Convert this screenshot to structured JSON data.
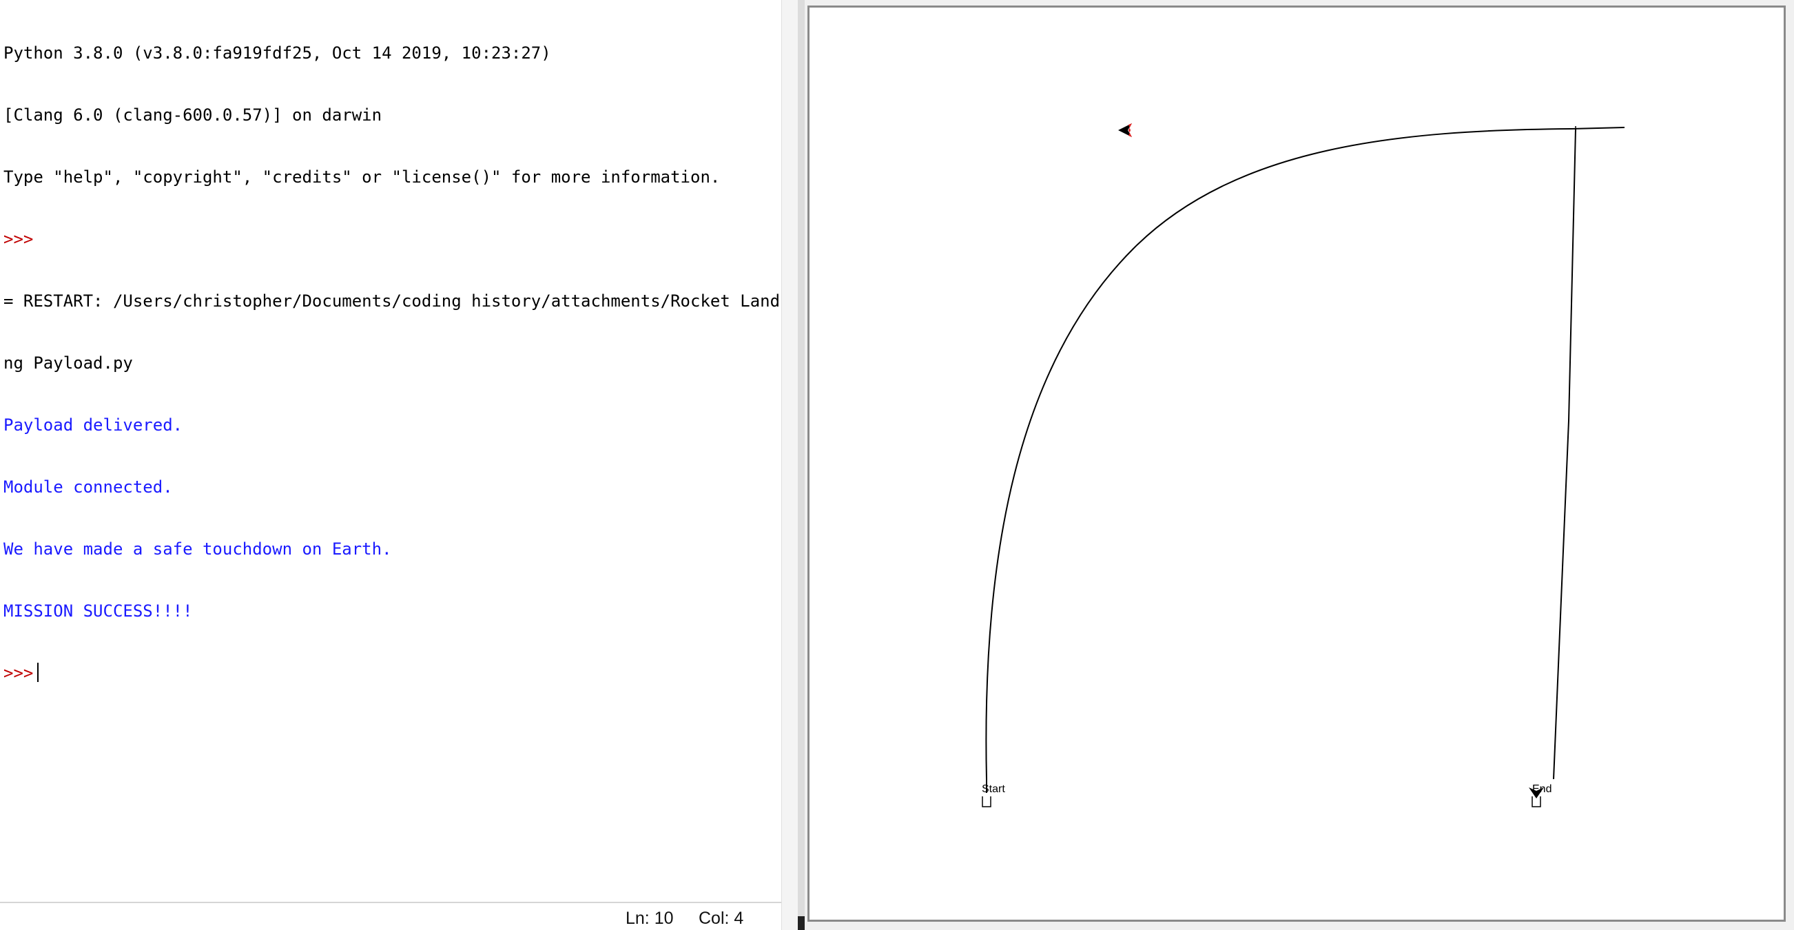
{
  "shell": {
    "lines": [
      "Python 3.8.0 (v3.8.0:fa919fdf25, Oct 14 2019, 10:23:27)",
      "[Clang 6.0 (clang-600.0.57)] on darwin",
      "Type \"help\", \"copyright\", \"credits\" or \"license()\" for more information."
    ],
    "prompt": ">>>",
    "restart_line_1": "= RESTART: /Users/christopher/Documents/coding history/attachments/Rocket Landi",
    "restart_line_2": "ng Payload.py",
    "output": [
      "Payload delivered.",
      "Module connected.",
      "We have made a safe touchdown on Earth.",
      "MISSION SUCCESS!!!!"
    ],
    "status": {
      "line": "Ln: 10",
      "col": "Col: 4"
    }
  },
  "turtle": {
    "start_label": "Start",
    "end_label": "End",
    "pen_color": "#000000",
    "turtle_accent": "#e02020"
  },
  "colors": {
    "output_text": "#1a1aff",
    "prompt": "#c00000"
  }
}
